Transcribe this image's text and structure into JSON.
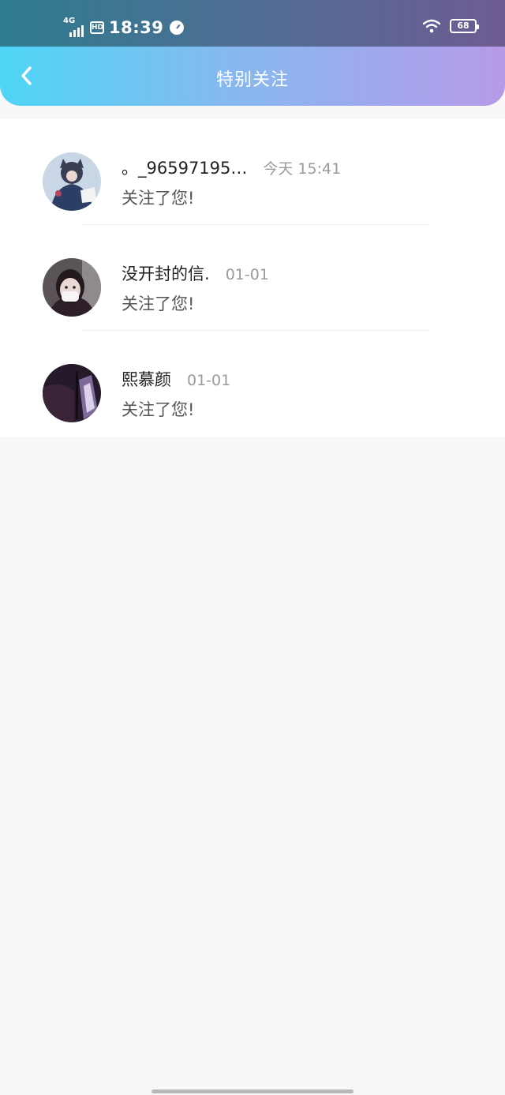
{
  "status_bar": {
    "network": "4G",
    "hd": "HD",
    "time": "18:39",
    "battery": "68"
  },
  "header": {
    "title": "特别关注",
    "back_icon": "chevron-left-icon"
  },
  "colors": {
    "header_start": "#4ed5f6",
    "header_end": "#b69ae8",
    "status_start": "#2e7c8f",
    "status_end": "#6d5c92",
    "page_bg": "#f9f7f8"
  },
  "items": [
    {
      "name": "。_96597195…",
      "time": "今天 15:41",
      "message": "关注了您!"
    },
    {
      "name": "没开封的信.",
      "time": "01-01",
      "message": "关注了您!"
    },
    {
      "name": "熙慕颜",
      "time": "01-01",
      "message": "关注了您!"
    }
  ]
}
